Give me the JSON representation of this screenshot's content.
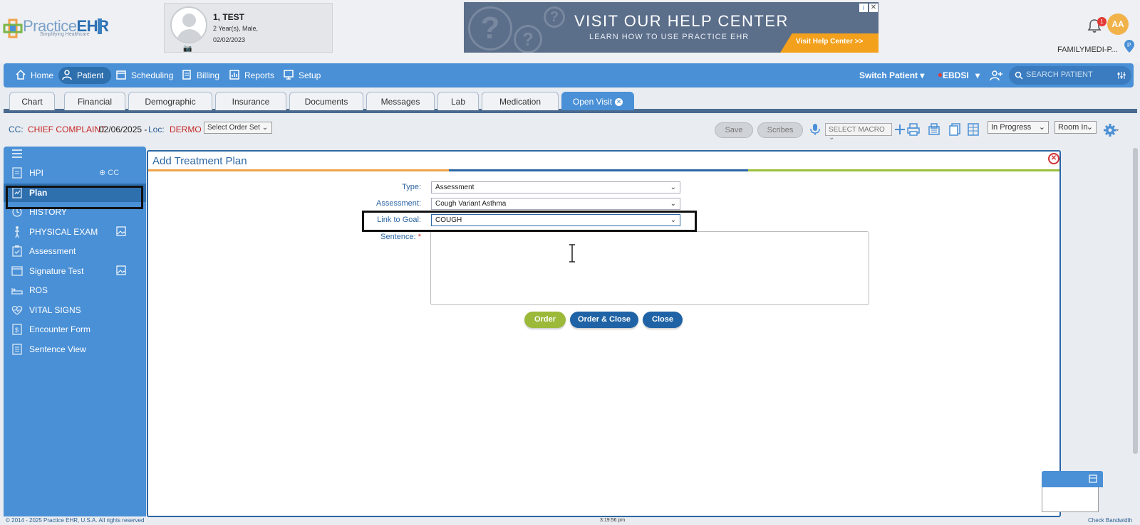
{
  "brand": {
    "logo_prefix": "Practice",
    "logo_suffix": "EHR",
    "tagline": "Simplifying Healthcare",
    "accent": "#4a90d6"
  },
  "patient": {
    "name": "1, TEST",
    "info": "2 Year(s), Male,",
    "dob": "02/02/2023"
  },
  "ad": {
    "title": "VISIT OUR HELP CENTER",
    "subtitle": "LEARN HOW TO USE PRACTICE EHR",
    "button": "Visit Help Center >>"
  },
  "header": {
    "notification_count": "1",
    "user_initials": "AA",
    "clinic": "FAMILYMEDI-P..."
  },
  "main_nav": {
    "items": [
      {
        "label": "Home",
        "icon": "home-icon"
      },
      {
        "label": "Patient",
        "icon": "user-icon"
      },
      {
        "label": "Scheduling",
        "icon": "calendar-icon"
      },
      {
        "label": "Billing",
        "icon": "billing-icon"
      },
      {
        "label": "Reports",
        "icon": "reports-icon"
      },
      {
        "label": "Setup",
        "icon": "monitor-icon"
      }
    ],
    "switch_patient": "Switch Patient",
    "facility": "EBDSI",
    "search_placeholder": "SEARCH PATIENT"
  },
  "tabs": [
    "Chart",
    "Financial",
    "Demographic",
    "Insurance",
    "Documents",
    "Messages",
    "Lab",
    "Medication",
    "Open Visit"
  ],
  "ccbar": {
    "cc_label": "CC:",
    "cc_value": "CHIEF COMPLAINT",
    "date": "02/06/2025 -",
    "loc_label": "Loc:",
    "loc_value": "DERMO",
    "order_set": "Select Order Set",
    "save": "Save",
    "scribes": "Scribes",
    "macro": "SELECT MACRO",
    "status": "In Progress",
    "room": "Room In"
  },
  "sidebar": {
    "cc_add": "CC",
    "items": [
      {
        "label": "HPI",
        "icon": "hpi-icon"
      },
      {
        "label": "Plan",
        "icon": "plan-icon"
      },
      {
        "label": "HISTORY",
        "icon": "history-icon"
      },
      {
        "label": "PHYSICAL EXAM",
        "icon": "person-icon"
      },
      {
        "label": "Assessment",
        "icon": "clipboard-icon"
      },
      {
        "label": "Signature Test",
        "icon": "window-icon"
      },
      {
        "label": "ROS",
        "icon": "bed-icon"
      },
      {
        "label": "VITAL SIGNS",
        "icon": "heart-icon"
      },
      {
        "label": "Encounter Form",
        "icon": "dollar-doc-icon"
      },
      {
        "label": "Sentence View",
        "icon": "document-icon"
      }
    ]
  },
  "dialog": {
    "title": "Add Treatment Plan",
    "type_label": "Type:",
    "type_value": "Assessment",
    "assessment_label": "Assessment:",
    "assessment_value": "Cough Variant Asthma",
    "goal_label": "Link to Goal:",
    "goal_value": "COUGH",
    "sentence_label": "Sentence:",
    "sentence_value": "",
    "order": "Order",
    "order_close": "Order & Close",
    "close": "Close"
  },
  "footer": {
    "copyright": "© 2014 - 2025 Practice EHR, U.S.A. All rights reserved",
    "time": "3:19:56 pm",
    "bandwidth": "Check Bandwidth"
  }
}
